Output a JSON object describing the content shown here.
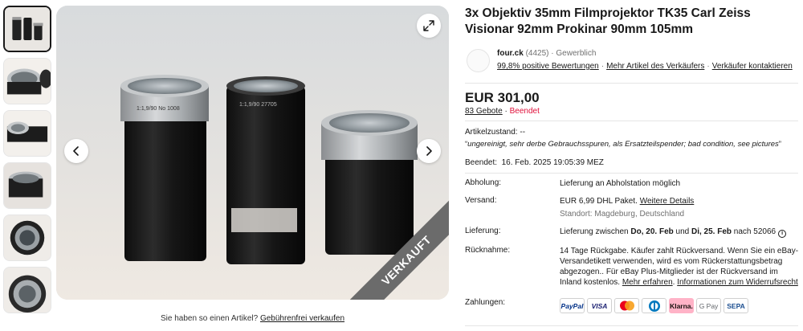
{
  "listing": {
    "title": "3x Objektiv 35mm Filmprojektor TK35 Carl Zeiss Visionar 92mm Prokinar 90mm 105mm"
  },
  "gallery": {
    "sold_ribbon": "VERKAUFT",
    "thumbnail_count": 6,
    "active_thumbnail": 1
  },
  "sell_note": {
    "text": "Sie haben so einen Artikel?",
    "link": "Gebührenfrei verkaufen"
  },
  "seller": {
    "name": "four.ck",
    "feedback_count": "(4425)",
    "sep": "·",
    "type": "Gewerblich",
    "positive": "99,8% positive Bewertungen",
    "more_items": "Mehr Artikel des Verkäufers",
    "contact": "Verkäufer kontaktieren"
  },
  "price": {
    "amount": "EUR 301,00",
    "bids": "83 Gebote",
    "sep": " · ",
    "status": "Beendet"
  },
  "condition": {
    "label": "Artikelzustand:",
    "value": "--",
    "desc_open": "“",
    "description": "ungereinigt, sehr derbe Gebrauchsspuren, als Ersatzteilspender; bad condition, see pictures",
    "desc_close": "”"
  },
  "ended": {
    "label": "Beendet:",
    "value": "16. Feb. 2025 19:05:39 MEZ"
  },
  "details": {
    "pickup_label": "Abholung:",
    "pickup_value": "Lieferung an Abholstation möglich",
    "shipping_label": "Versand:",
    "shipping_price": "EUR 6,99 DHL Paket.",
    "shipping_link": "Weitere Details",
    "shipping_location": "Standort: Magdeburg, Deutschland",
    "delivery_label": "Lieferung:",
    "delivery_prefix": "Lieferung zwischen",
    "delivery_from": "Do, 20. Feb",
    "delivery_and": "und",
    "delivery_to": "Di, 25. Feb",
    "delivery_suffix": "nach 52066",
    "info_glyph": "i",
    "returns_label": "Rücknahme:",
    "returns_text": "14 Tage Rückgabe. Käufer zahlt Rückversand. Wenn Sie ein eBay-Versandetikett verwenden, wird es vom Rückerstattungsbetrag abgezogen.. Für eBay Plus-Mitglieder ist der Rückversand im Inland kostenlos.",
    "returns_more": "Mehr erfahren",
    "returns_dot": ". ",
    "returns_policy": "Informationen zum Widerrufsrecht",
    "payments_label": "Zahlungen:"
  },
  "payments": [
    "PayPal",
    "VISA",
    "Mastercard",
    "Diners Club",
    "Klarna.",
    "G Pay",
    "SEPA"
  ],
  "colors": {
    "ended_red": "#e0103a",
    "ribbon_gray": "#6b6b6b",
    "klarna_pink": "#ffb3c7",
    "paypal_blue": "#003087",
    "visa_blue": "#1a1f71"
  },
  "image_text": {
    "lens1_engraving": "1:1,9/90 No 1008",
    "lens2_engraving": "1:1,9/90 27705"
  }
}
